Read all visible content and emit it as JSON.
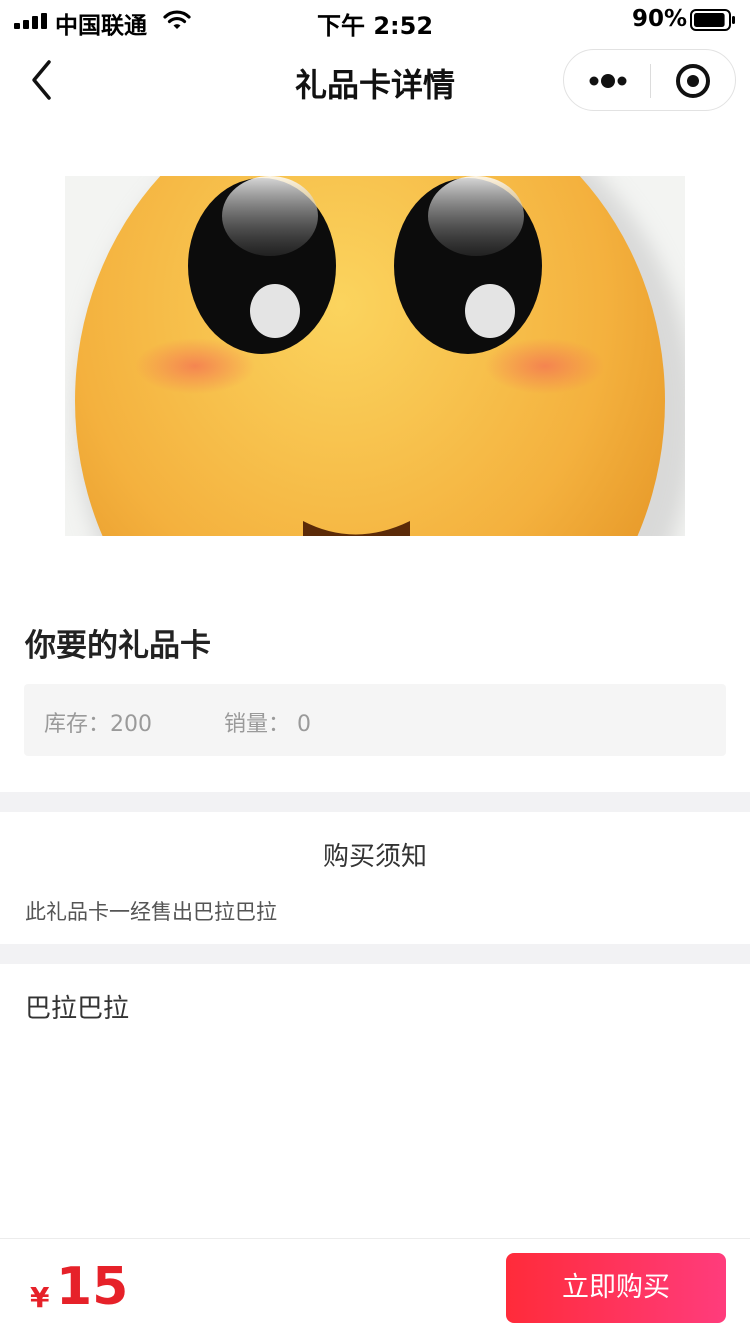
{
  "status_bar": {
    "carrier": "中国联通",
    "time": "下午 2:52",
    "battery_percent": "90%",
    "battery_level": 0.9
  },
  "nav": {
    "title": "礼品卡详情",
    "back_icon": "chevron-left-icon",
    "more_icon": "more-dots-icon",
    "close_icon": "target-circle-icon"
  },
  "hero": {
    "image_subject": "smiling-emoji-face"
  },
  "product": {
    "name": "你要的礼品卡",
    "stock_text": "库存：200",
    "sales_text": "销量： 0"
  },
  "notice": {
    "title": "购买须知",
    "text": "此礼品卡一经售出巴拉巴拉"
  },
  "detail": {
    "text": "巴拉巴拉"
  },
  "bottom_bar": {
    "currency": "¥",
    "price": "15",
    "buy_label": "立即购买"
  },
  "colors": {
    "price": "#e62129",
    "buy_gradient_start": "#ff2b3a",
    "buy_gradient_end": "#ff3c7c",
    "section_gap": "#f2f2f4"
  }
}
